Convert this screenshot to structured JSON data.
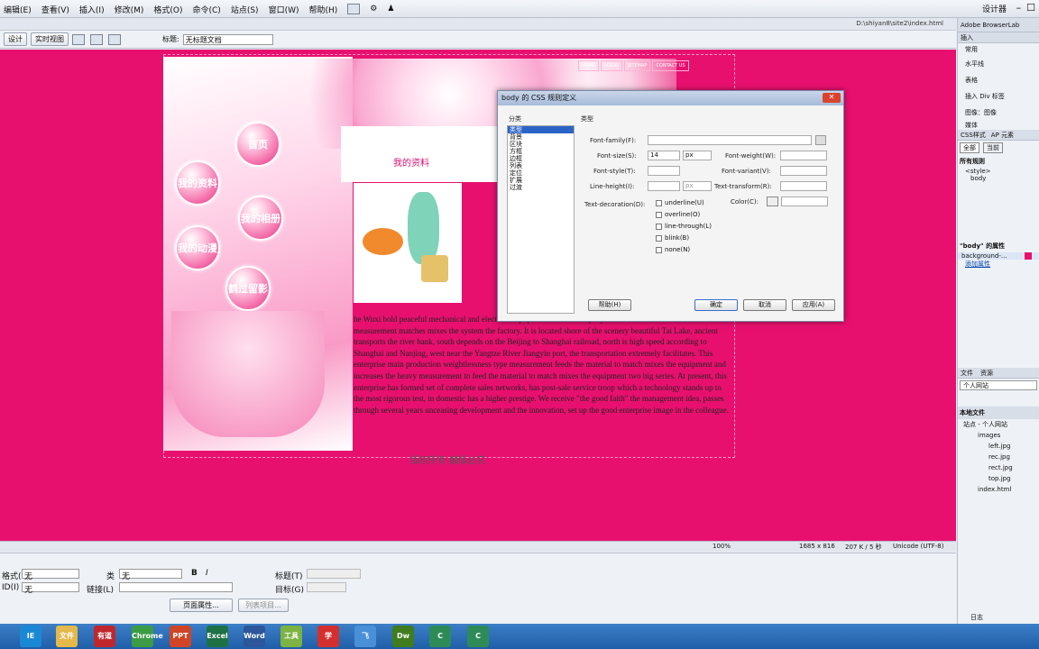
{
  "menu": [
    "编辑(E)",
    "查看(V)",
    "插入(I)",
    "修改(M)",
    "格式(O)",
    "命令(C)",
    "站点(S)",
    "窗口(W)",
    "帮助(H)"
  ],
  "workspace": "设计器",
  "path": "D:\\shiyan8\\site2\\index.html",
  "toolbar": {
    "design": "设计",
    "live": "实时视图",
    "title_label": "标题:",
    "title_value": "无标题文档"
  },
  "page": {
    "nav": [
      "HOME",
      "LOGIN",
      "SITEMAP",
      "CONTACT US"
    ],
    "bubbles": [
      "首页",
      "我的资料",
      "我的相册",
      "我的动漫",
      "鹤过留影"
    ],
    "header_title": "我的资料",
    "article": "he Wuxi bold peaceful mechanical and electrical equipment limited company measurement the material measurement matches mixes the system the factory. It is located shore of the scenery beautiful Tai Lake, ancient transports the river bank, south depends on the Beijing to Shanghai railroad, north is high speed according to Shanghai and Nanjing, west near the Yangtze River Jiangyin port, the transportation extremely facilitates. This enterprise main production weightlessness type measurement feeds the material to match mixes the equipment and increases the heavy measurement to feed the material to match mixes the equipment two big series. At present, this enterprise has formed set of complete sales networks, has post-sale service troop which a technology stands up to the most rigorous test, in domestic has a higher prestige. We receive \"the good faith\" the management idea, passes through several years unceasing development and the innovation, set up the good enterprise image in the colleague.",
    "footer": "版权所有 翻版必究"
  },
  "dialog": {
    "title": "body 的 CSS 规则定义",
    "close": "✕",
    "category_header": "分类",
    "categories": [
      "类型",
      "背景",
      "区块",
      "方框",
      "边框",
      "列表",
      "定位",
      "扩展",
      "过渡"
    ],
    "section": "类型",
    "font_family": "Font-family(F):",
    "font_size": "Font-size(S):",
    "font_size_val": "14",
    "font_size_unit": "px",
    "font_weight": "Font-weight(W):",
    "font_style": "Font-style(T):",
    "font_variant": "Font-variant(V):",
    "line_height": "Line-height(I):",
    "line_height_unit": "px",
    "text_transform": "Text-transform(R):",
    "text_decoration": "Text-decoration(D):",
    "color": "Color(C):",
    "decorations": [
      "underline(U)",
      "overline(O)",
      "line-through(L)",
      "blink(B)",
      "none(N)"
    ],
    "help": "帮助(H)",
    "ok": "确定",
    "cancel": "取消",
    "apply": "应用(A)"
  },
  "right": {
    "browserlab": "Adobe BrowserLab",
    "insert": "插入",
    "common": "常用",
    "items": [
      "水平线",
      "表格",
      "插入 Div 标签",
      "图像：图像",
      "媒体"
    ],
    "css_tab": "CSS样式",
    "ap_tab": "AP 元素",
    "all": "全部",
    "current": "当前",
    "rules": "所有规则",
    "rule1": "<style>",
    "rule2": "body",
    "props_title": "\"body\" 的属性",
    "prop1": "background-...",
    "add_prop": "添加属性",
    "files": "文件",
    "assets": "资源",
    "site": "个人网站",
    "local": "本地文件",
    "tree": [
      "站点 - 个人网站",
      "images",
      "left.jpg",
      "rec.jpg",
      "rect.jpg",
      "top.jpg",
      "index.html"
    ],
    "log": "日志"
  },
  "status": {
    "zoom": "100%",
    "size": "1685 x 816",
    "filesize": "207 K / 5 秒",
    "encoding": "Unicode (UTF-8)"
  },
  "props": {
    "format": "格式(F)",
    "none": "无",
    "class": "类",
    "id": "ID(I)",
    "link": "链接(L)",
    "target": "目标(G)",
    "title": "标题(T)",
    "page_props": "页面属性...",
    "list_item": "列表项目..."
  },
  "taskbar": [
    "IE",
    "文件",
    "有道",
    "Chrome",
    "PPT",
    "Excel",
    "Word",
    "工具",
    "学",
    "飞",
    "Dw",
    "C",
    "C"
  ]
}
